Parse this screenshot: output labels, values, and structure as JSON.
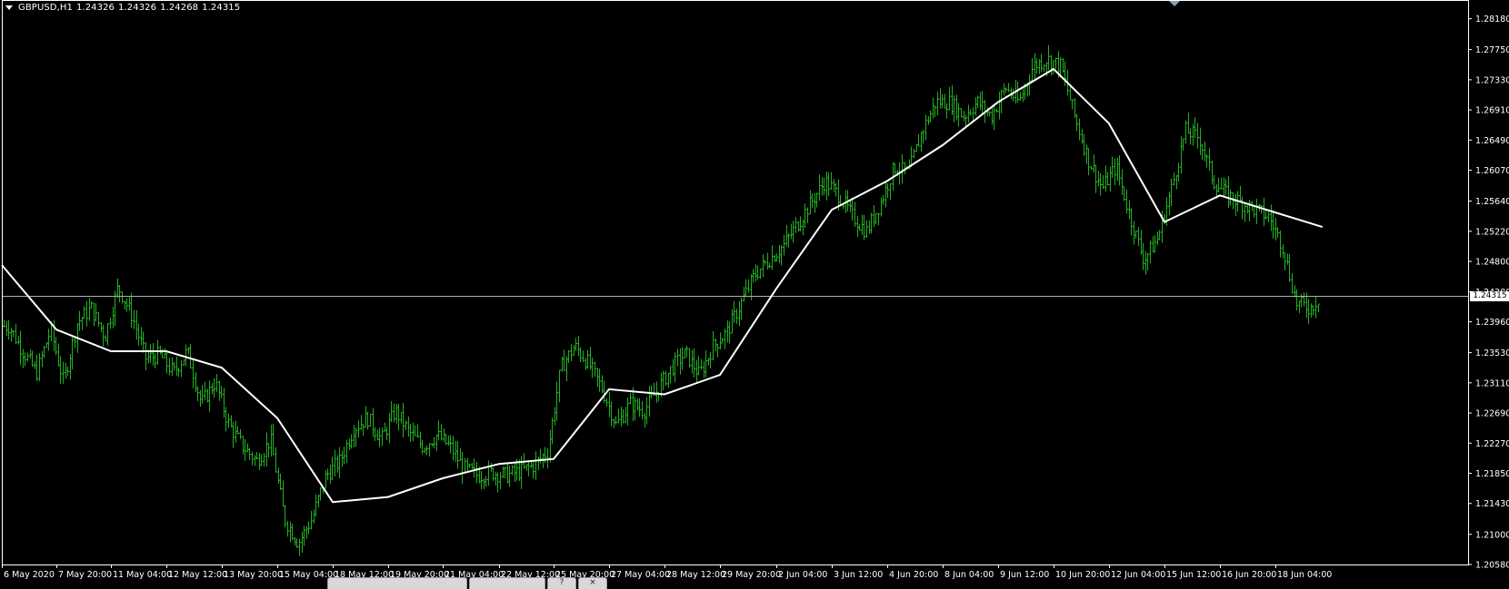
{
  "window": {
    "symbol": "GBPUSD,H1",
    "ohlc": [
      "1.24326",
      "1.24326",
      "1.24268",
      "1.24315"
    ]
  },
  "bottom_tabs": [
    {
      "label": "?",
      "icon": "help-icon"
    },
    {
      "label": "×",
      "icon": "close-icon"
    }
  ],
  "colors": {
    "background": "#000000",
    "bars": "#22b022",
    "moving_average": "#ffffff",
    "axis": "#ffffff",
    "bid_line": "#b0b0b0",
    "price_tag_bg": "#ffffff"
  },
  "chart_data": {
    "type": "ohlc_bars_with_moving_average",
    "symbol": "GBPUSD",
    "timeframe": "H1",
    "current_price": 1.24315,
    "grid": false,
    "ylim": [
      1.2058,
      1.2839
    ],
    "y_ticks": [
      "1.28180",
      "1.27750",
      "1.27330",
      "1.26910",
      "1.26490",
      "1.26070",
      "1.25640",
      "1.25220",
      "1.24800",
      "1.24380",
      "1.23960",
      "1.23530",
      "1.23110",
      "1.22690",
      "1.22270",
      "1.21850",
      "1.21430",
      "1.21000",
      "1.20580"
    ],
    "x_ticks": [
      "6 May 2020",
      "7 May 20:00",
      "11 May 04:00",
      "12 May 12:00",
      "13 May 20:00",
      "15 May 04:00",
      "18 May 12:00",
      "19 May 20:00",
      "21 May 04:00",
      "22 May 12:00",
      "25 May 20:00",
      "27 May 04:00",
      "28 May 12:00",
      "29 May 20:00",
      "2 Jun 04:00",
      "3 Jun 12:00",
      "4 Jun 20:00",
      "8 Jun 04:00",
      "9 Jun 12:00",
      "10 Jun 20:00",
      "12 Jun 04:00",
      "15 Jun 12:00",
      "16 Jun 20:00",
      "18 Jun 04:00"
    ],
    "price_path": [
      [
        "6 May 2020",
        1.239
      ],
      [
        "6 May 2020",
        1.2355
      ],
      [
        "6 May 2020",
        1.2325
      ],
      [
        "6 May 2020",
        1.2385
      ],
      [
        "7 May 20:00",
        1.2312
      ],
      [
        "7 May 20:00",
        1.2395
      ],
      [
        "7 May 20:00",
        1.2415
      ],
      [
        "7 May 20:00",
        1.2375
      ],
      [
        "11 May 04:00",
        1.2445
      ],
      [
        "11 May 04:00",
        1.2405
      ],
      [
        "11 May 04:00",
        1.2345
      ],
      [
        "11 May 04:00",
        1.235
      ],
      [
        "12 May 12:00",
        1.2325
      ],
      [
        "12 May 12:00",
        1.2355
      ],
      [
        "12 May 12:00",
        1.2282
      ],
      [
        "12 May 12:00",
        1.2312
      ],
      [
        "13 May 20:00",
        1.2252
      ],
      [
        "13 May 20:00",
        1.2222
      ],
      [
        "13 May 20:00",
        1.2202
      ],
      [
        "13 May 20:00",
        1.2232
      ],
      [
        "15 May 04:00",
        1.2122
      ],
      [
        "15 May 04:00",
        1.2088
      ],
      [
        "15 May 04:00",
        1.2122
      ],
      [
        "15 May 04:00",
        1.2182
      ],
      [
        "18 May 12:00",
        1.2202
      ],
      [
        "18 May 12:00",
        1.2248
      ],
      [
        "18 May 12:00",
        1.2262
      ],
      [
        "18 May 12:00",
        1.2232
      ],
      [
        "19 May 20:00",
        1.2272
      ],
      [
        "19 May 20:00",
        1.2242
      ],
      [
        "19 May 20:00",
        1.2222
      ],
      [
        "19 May 20:00",
        1.2238
      ],
      [
        "21 May 04:00",
        1.2222
      ],
      [
        "21 May 04:00",
        1.2192
      ],
      [
        "21 May 04:00",
        1.2182
      ],
      [
        "21 May 04:00",
        1.2186
      ],
      [
        "22 May 12:00",
        1.2182
      ],
      [
        "22 May 12:00",
        1.2188
      ],
      [
        "22 May 12:00",
        1.2196
      ],
      [
        "22 May 12:00",
        1.2216
      ],
      [
        "25 May 20:00",
        1.2332
      ],
      [
        "25 May 20:00",
        1.2362
      ],
      [
        "25 May 20:00",
        1.2338
      ],
      [
        "25 May 20:00",
        1.2302
      ],
      [
        "27 May 04:00",
        1.2252
      ],
      [
        "27 May 04:00",
        1.2282
      ],
      [
        "27 May 04:00",
        1.2272
      ],
      [
        "27 May 04:00",
        1.2302
      ],
      [
        "28 May 12:00",
        1.2332
      ],
      [
        "28 May 12:00",
        1.2352
      ],
      [
        "28 May 12:00",
        1.2322
      ],
      [
        "28 May 12:00",
        1.2362
      ],
      [
        "29 May 20:00",
        1.2382
      ],
      [
        "29 May 20:00",
        1.2422
      ],
      [
        "29 May 20:00",
        1.2462
      ],
      [
        "29 May 20:00",
        1.2482
      ],
      [
        "2 Jun 04:00",
        1.2502
      ],
      [
        "2 Jun 04:00",
        1.2532
      ],
      [
        "2 Jun 04:00",
        1.2562
      ],
      [
        "2 Jun 04:00",
        1.2592
      ],
      [
        "3 Jun 12:00",
        1.2572
      ],
      [
        "3 Jun 12:00",
        1.2542
      ],
      [
        "3 Jun 12:00",
        1.2522
      ],
      [
        "3 Jun 12:00",
        1.2562
      ],
      [
        "4 Jun 20:00",
        1.2612
      ],
      [
        "4 Jun 20:00",
        1.2602
      ],
      [
        "4 Jun 20:00",
        1.2662
      ],
      [
        "4 Jun 20:00",
        1.2702
      ],
      [
        "8 Jun 04:00",
        1.2702
      ],
      [
        "8 Jun 04:00",
        1.2682
      ],
      [
        "8 Jun 04:00",
        1.2702
      ],
      [
        "8 Jun 04:00",
        1.2682
      ],
      [
        "9 Jun 12:00",
        1.2722
      ],
      [
        "9 Jun 12:00",
        1.2702
      ],
      [
        "9 Jun 12:00",
        1.2752
      ],
      [
        "9 Jun 12:00",
        1.2762
      ],
      [
        "10 Jun 20:00",
        1.2752
      ],
      [
        "10 Jun 20:00",
        1.2682
      ],
      [
        "10 Jun 20:00",
        1.2622
      ],
      [
        "10 Jun 20:00",
        1.2582
      ],
      [
        "12 Jun 04:00",
        1.2612
      ],
      [
        "12 Jun 04:00",
        1.2542
      ],
      [
        "12 Jun 04:00",
        1.2482
      ],
      [
        "12 Jun 04:00",
        1.2512
      ],
      [
        "15 Jun 12:00",
        1.2582
      ],
      [
        "15 Jun 12:00",
        1.2662
      ],
      [
        "15 Jun 12:00",
        1.2652
      ],
      [
        "15 Jun 12:00",
        1.2592
      ],
      [
        "16 Jun 20:00",
        1.2572
      ],
      [
        "16 Jun 20:00",
        1.2562
      ],
      [
        "16 Jun 20:00",
        1.2552
      ],
      [
        "16 Jun 20:00",
        1.2542
      ],
      [
        "18 Jun 04:00",
        1.2502
      ],
      [
        "18 Jun 04:00",
        1.2422
      ],
      [
        "18 Jun 04:00",
        1.2415
      ],
      [
        "18 Jun 04:00",
        1.24315
      ]
    ],
    "moving_average": [
      [
        "6 May 2020",
        1.2475
      ],
      [
        "7 May 20:00",
        1.2385
      ],
      [
        "11 May 04:00",
        1.2355
      ],
      [
        "12 May 12:00",
        1.2355
      ],
      [
        "13 May 20:00",
        1.2332
      ],
      [
        "15 May 04:00",
        1.2262
      ],
      [
        "18 May 12:00",
        1.2145
      ],
      [
        "19 May 20:00",
        1.2152
      ],
      [
        "21 May 04:00",
        1.2178
      ],
      [
        "22 May 12:00",
        1.2198
      ],
      [
        "25 May 20:00",
        1.2205
      ],
      [
        "27 May 04:00",
        1.2302
      ],
      [
        "28 May 12:00",
        1.2295
      ],
      [
        "29 May 20:00",
        1.2322
      ],
      [
        "2 Jun 04:00",
        1.2442
      ],
      [
        "3 Jun 12:00",
        1.2552
      ],
      [
        "4 Jun 20:00",
        1.2592
      ],
      [
        "8 Jun 04:00",
        1.2642
      ],
      [
        "9 Jun 12:00",
        1.2702
      ],
      [
        "10 Jun 20:00",
        1.2748
      ],
      [
        "12 Jun 04:00",
        1.2672
      ],
      [
        "15 Jun 12:00",
        1.2535
      ],
      [
        "16 Jun 20:00",
        1.2572
      ],
      [
        "18 Jun 04:00",
        1.2528
      ]
    ]
  }
}
